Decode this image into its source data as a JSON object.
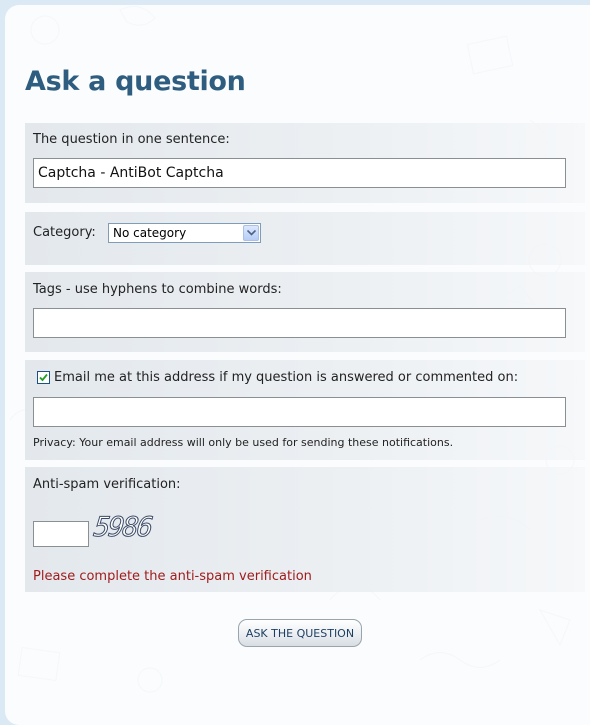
{
  "page": {
    "title": "Ask a question"
  },
  "question": {
    "label": "The question in one sentence:",
    "value": "Captcha - AntiBot Captcha"
  },
  "category": {
    "label": "Category:",
    "selected": "No category"
  },
  "tags": {
    "label": "Tags - use hyphens to combine words:",
    "value": ""
  },
  "email": {
    "checkbox_checked": true,
    "checkbox_label": "Email me at this address if my question is answered or commented on:",
    "value": "",
    "privacy_note": "Privacy: Your email address will only be used for sending these notifications."
  },
  "antispam": {
    "label": "Anti-spam verification:",
    "value": "",
    "captcha_text": "5986",
    "error": "Please complete the anti-spam verification"
  },
  "submit": {
    "label": "ASK THE QUESTION"
  },
  "colors": {
    "title": "#2e5d80",
    "error": "#a01c1c",
    "background": "#dbe9f4"
  },
  "icons": {
    "select_arrow": "chevron-down-icon",
    "checkbox_mark": "check-icon"
  }
}
